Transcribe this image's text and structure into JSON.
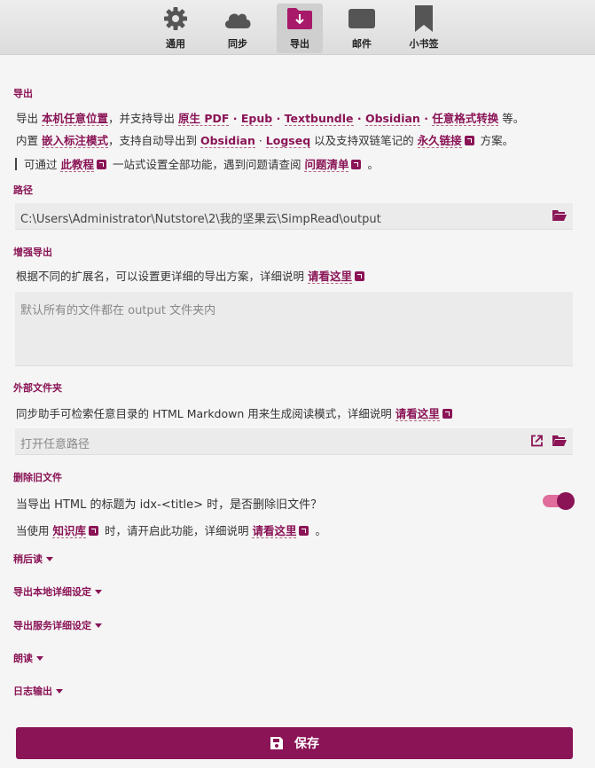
{
  "tabs": [
    {
      "label": "通用",
      "icon": "gear-icon"
    },
    {
      "label": "同步",
      "icon": "cloud-icon"
    },
    {
      "label": "导出",
      "icon": "export-folder-icon"
    },
    {
      "label": "邮件",
      "icon": "mail-icon"
    },
    {
      "label": "小书签",
      "icon": "bookmark-icon"
    }
  ],
  "export": {
    "heading": "导出",
    "line1": {
      "p1": "导出 ",
      "local": "本机任意位置",
      "p2": "，并支持导出 ",
      "pdf": "原生 PDF",
      "epub": "Epub",
      "textbundle": "Textbundle",
      "obsidian": "Obsidian",
      "anyformat": "任意格式转换",
      "p3": " 等。"
    },
    "line2": {
      "p1": "内置 ",
      "mark": "嵌入标注模式",
      "p2": "，支持自动导出到 ",
      "obsidian": "Obsidian",
      "logseq": "Logseq",
      "p3": " 以及支持双链笔记的 ",
      "permalink": "永久链接",
      "p4": " 方案。"
    },
    "line3": {
      "p1": "可通过 ",
      "tutorial": "此教程",
      "p2": " 一站式设置全部功能，遇到问题请查阅 ",
      "issues": "问题清单",
      "p3": " 。"
    },
    "sep": " · "
  },
  "path": {
    "heading": "路径",
    "value": "C:\\Users\\Administrator\\Nutstore\\2\\我的坚果云\\SimpRead\\output"
  },
  "enhanced": {
    "heading": "增强导出",
    "desc": "根据不同的扩展名，可以设置更详细的导出方案，详细说明 ",
    "link": "请看这里",
    "placeholder": "默认所有的文件都在 output 文件夹内"
  },
  "external": {
    "heading": "外部文件夹",
    "desc": "同步助手可检索任意目录的 HTML Markdown 用来生成阅读模式，详细说明 ",
    "link": "请看这里",
    "placeholder": "打开任意路径"
  },
  "delete_old": {
    "heading": "删除旧文件",
    "question": "当导出 HTML 的标题为 idx-<title> 时，是否删除旧文件？",
    "enabled": true,
    "note_p1": "当使用 ",
    "note_link1": "知识库",
    "note_p2": " 时，请开启此功能，详细说明 ",
    "note_link2": "请看这里",
    "note_p3": " 。"
  },
  "sections": [
    "稍后读",
    "导出本地详细设定",
    "导出服务详细设定",
    "朗读",
    "日志输出"
  ],
  "save_label": "保存",
  "colors": {
    "accent": "#8a1456",
    "toggle_track": "#e06d9c"
  }
}
